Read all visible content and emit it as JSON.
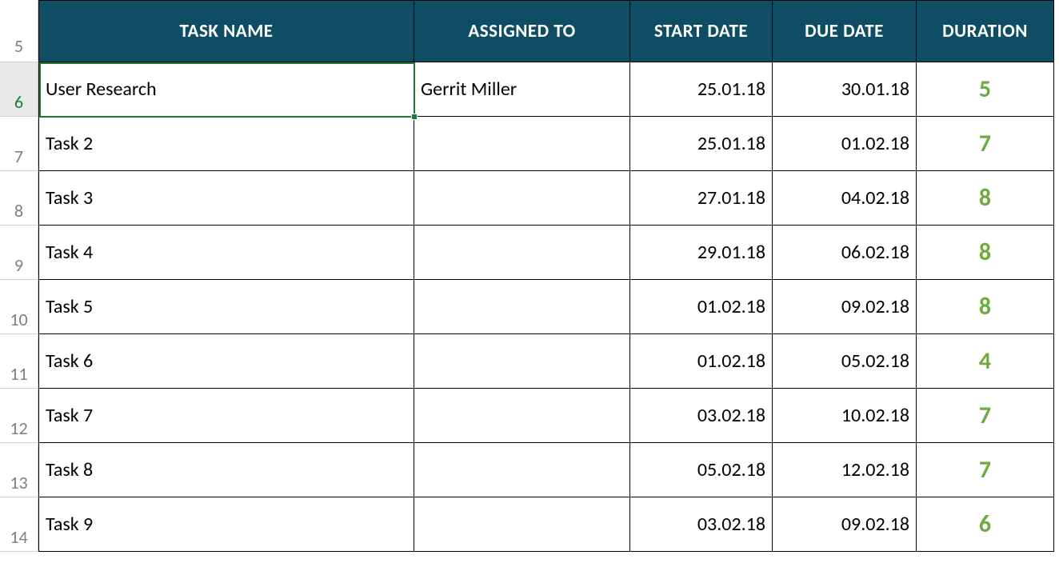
{
  "colors": {
    "header_bg": "#0e4d63",
    "duration_text": "#6eab3f",
    "selection": "#1a7a3a"
  },
  "headers": {
    "task_name": "TASK NAME",
    "assigned_to": "ASSIGNED TO",
    "start_date": "START DATE",
    "due_date": "DUE DATE",
    "duration": "DURATION"
  },
  "row_numbers": [
    "5",
    "6",
    "7",
    "8",
    "9",
    "10",
    "11",
    "12",
    "13",
    "14"
  ],
  "active_row_index": 1,
  "rows": [
    {
      "task_name": "User Research",
      "assigned_to": "Gerrit Miller",
      "start_date": "25.01.18",
      "due_date": "30.01.18",
      "duration": "5"
    },
    {
      "task_name": "Task 2",
      "assigned_to": "",
      "start_date": "25.01.18",
      "due_date": "01.02.18",
      "duration": "7"
    },
    {
      "task_name": "Task 3",
      "assigned_to": "",
      "start_date": "27.01.18",
      "due_date": "04.02.18",
      "duration": "8"
    },
    {
      "task_name": "Task 4",
      "assigned_to": "",
      "start_date": "29.01.18",
      "due_date": "06.02.18",
      "duration": "8"
    },
    {
      "task_name": "Task 5",
      "assigned_to": "",
      "start_date": "01.02.18",
      "due_date": "09.02.18",
      "duration": "8"
    },
    {
      "task_name": "Task 6",
      "assigned_to": "",
      "start_date": "01.02.18",
      "due_date": "05.02.18",
      "duration": "4"
    },
    {
      "task_name": "Task 7",
      "assigned_to": "",
      "start_date": "03.02.18",
      "due_date": "10.02.18",
      "duration": "7"
    },
    {
      "task_name": "Task 8",
      "assigned_to": "",
      "start_date": "05.02.18",
      "due_date": "12.02.18",
      "duration": "7"
    },
    {
      "task_name": "Task 9",
      "assigned_to": "",
      "start_date": "03.02.18",
      "due_date": "09.02.18",
      "duration": "6"
    }
  ]
}
